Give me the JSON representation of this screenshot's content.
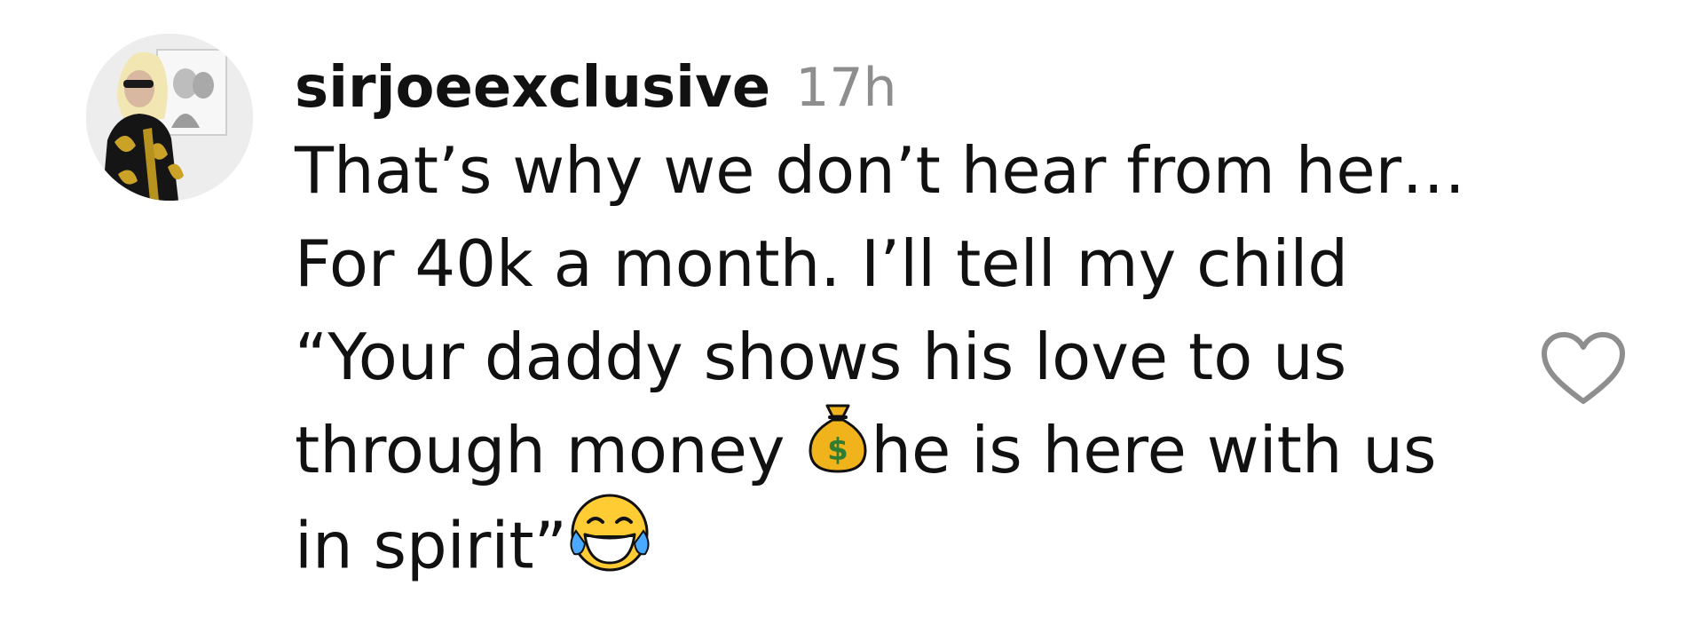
{
  "comment": {
    "username": "sirjoeexclusive",
    "timestamp": "17h",
    "text_lines": [
      "That’s why we don’t hear from her…",
      "For 40k a month. I’ll tell my child",
      "“Your daddy shows his love to us",
      "through money ",
      "he is here with us",
      "in spirit”"
    ],
    "emojis": [
      "money-bag",
      "face-with-tears-of-joy"
    ]
  },
  "colors": {
    "text": "#111111",
    "timestamp": "#8e8e8e",
    "heart_outline": "#8e8e8e",
    "background": "#ffffff"
  },
  "icons": {
    "like": "heart-outline-icon",
    "money": "money-bag-emoji",
    "laugh": "tears-of-joy-emoji"
  }
}
